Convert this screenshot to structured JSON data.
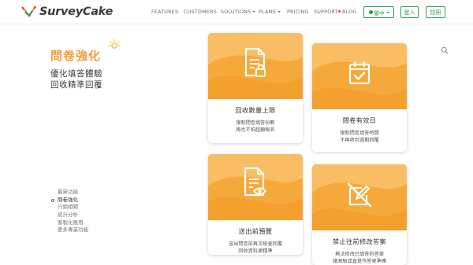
{
  "header": {
    "logo_text": "SurveyCake",
    "nav": [
      {
        "label": "FEATURES",
        "has_caret": false
      },
      {
        "label": "CUSTOMERS",
        "has_caret": false
      },
      {
        "label": "SOLUTIONS",
        "has_caret": true
      },
      {
        "label": "PLANS",
        "has_caret": true
      },
      {
        "label": "PRICING",
        "has_caret": false
      },
      {
        "label": "SUPPORT",
        "has_caret": false
      },
      {
        "label": "BLOG",
        "has_caret": false
      }
    ],
    "language_label": "繁中",
    "login_label": "登入",
    "signup_label": "註冊"
  },
  "section": {
    "title": "問卷強化",
    "subtitle_line1": "優化填答體驗",
    "subtitle_line2": "回收精準回覆"
  },
  "side_nav": {
    "items": [
      {
        "label": "最新功能",
        "active": false
      },
      {
        "label": "問卷強化",
        "active": true
      },
      {
        "label": "行銷相關",
        "active": false
      },
      {
        "label": "統計分析",
        "active": false
      },
      {
        "label": "客製化應用",
        "active": false
      },
      {
        "label": "更多專業功能",
        "active": false
      }
    ]
  },
  "cards": [
    {
      "title": "回收數量上限",
      "desc_line1": "限制問卷填答份數",
      "desc_line2": "再也不怕超額報名",
      "icon": "document-lock-icon"
    },
    {
      "title": "問卷有效日",
      "desc_line1": "限制問卷填答時間",
      "desc_line2": "不再收到過期回覆",
      "icon": "calendar-check-icon"
    },
    {
      "title": "送出前預覽",
      "desc_line1": "送出問卷前再次檢查回覆",
      "desc_line2": "回收資料更精準",
      "icon": "document-eye-icon"
    },
    {
      "title": "禁止往前修改答案",
      "desc_line1": "無法修改已填答的答案",
      "desc_line2": "讓測驗或直覺作答更準確",
      "icon": "no-edit-icon"
    }
  ],
  "colors": {
    "accent_orange": "#f6a93b",
    "brand_green": "#2e9a57",
    "title_orange": "#f0a03c"
  }
}
